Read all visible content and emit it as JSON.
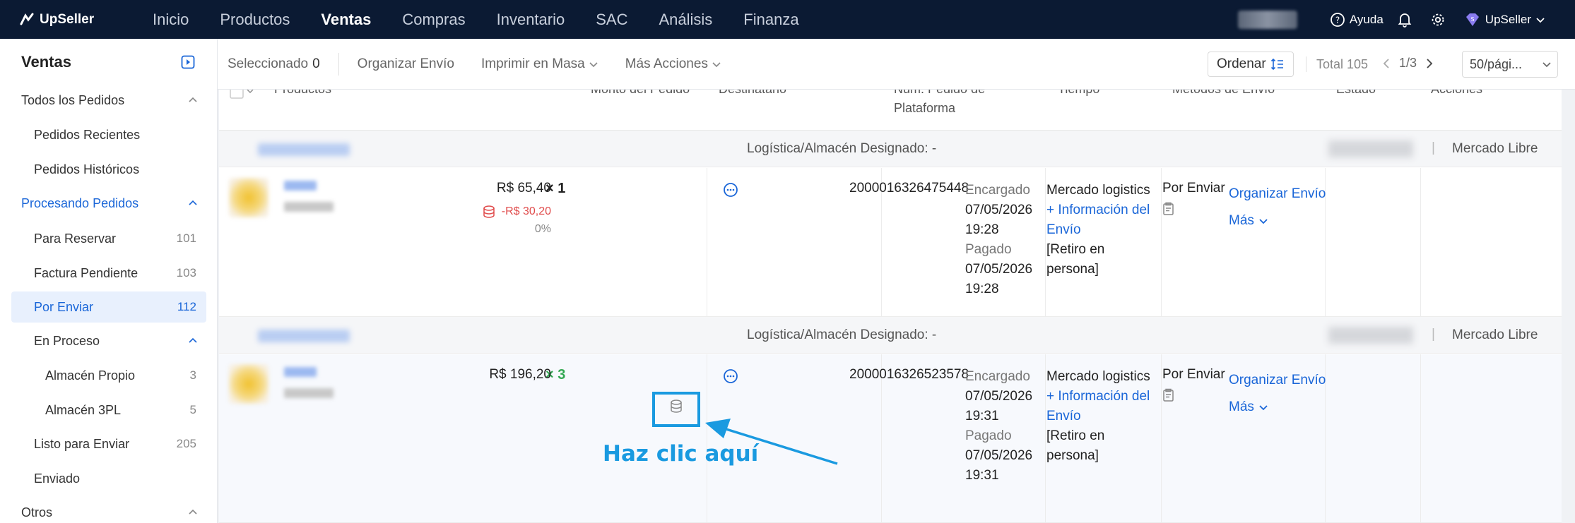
{
  "app": {
    "brand": "UpSeller",
    "nav": [
      "Inicio",
      "Productos",
      "Ventas",
      "Compras",
      "Inventario",
      "SAC",
      "Análisis",
      "Finanza"
    ],
    "active_nav": "Ventas",
    "help": "Ayuda",
    "user": "UpSeller"
  },
  "sidebar": {
    "title": "Ventas",
    "items": [
      {
        "label": "Todos los Pedidos",
        "count": ""
      },
      {
        "label": "Pedidos Recientes",
        "count": ""
      },
      {
        "label": "Pedidos Históricos",
        "count": ""
      },
      {
        "label": "Procesando Pedidos",
        "count": ""
      },
      {
        "label": "Para Reservar",
        "count": "101"
      },
      {
        "label": "Factura Pendiente",
        "count": "103"
      },
      {
        "label": "Por Enviar",
        "count": "112"
      },
      {
        "label": "En Proceso",
        "count": ""
      },
      {
        "label": "Almacén Propio",
        "count": "3"
      },
      {
        "label": "Almacén 3PL",
        "count": "5"
      },
      {
        "label": "Listo para Enviar",
        "count": "205"
      },
      {
        "label": "Enviado",
        "count": ""
      },
      {
        "label": "Otros",
        "count": ""
      }
    ]
  },
  "toolbar": {
    "selected_label": "Seleccionado",
    "selected_count": "0",
    "organize": "Organizar Envío",
    "print": "Imprimir en Masa",
    "more": "Más Acciones",
    "order": "Ordenar",
    "total": "Total 105",
    "page": "1/3",
    "per_page": "50/pági..."
  },
  "table": {
    "headers": {
      "products": "Productos",
      "amount": "Monto del Pedido",
      "recipient": "Destinatario",
      "order_no": "Núm. Pedido de Plataforma",
      "time": "Tiempo",
      "shipping": "Métodos de Envío",
      "status": "Estado",
      "actions": "Acciones"
    },
    "group_label": "Logística/Almacén Designado: -",
    "platform": "Mercado Libre",
    "rows": [
      {
        "qty": "× 1",
        "amount": "R$ 65,40",
        "discount": "-R$ 30,20",
        "percent": "0%",
        "order_no": "2000016326475448",
        "ordered_label": "Encargado",
        "ordered_date": "07/05/2026",
        "ordered_time": "19:28",
        "paid_label": "Pagado",
        "paid_date": "07/05/2026",
        "paid_time": "19:28",
        "ship_method": "Mercado logistics",
        "ship_info": "+ Información del Envío",
        "ship_type": "[Retiro en persona]",
        "status": "Por Enviar",
        "action": "Organizar Envío",
        "more": "Más"
      },
      {
        "qty": "× 3",
        "amount": "R$ 196,20",
        "order_no": "2000016326523578",
        "ordered_label": "Encargado",
        "ordered_date": "07/05/2026",
        "ordered_time": "19:31",
        "paid_label": "Pagado",
        "paid_date": "07/05/2026",
        "paid_time": "19:31",
        "ship_method": "Mercado logistics",
        "ship_info": "+ Información del Envío",
        "ship_type": "[Retiro en persona]",
        "status": "Por Enviar",
        "action": "Organizar Envío",
        "more": "Más"
      }
    ]
  },
  "annotation": {
    "callout": "Haz clic aquí"
  },
  "colors": {
    "nav_bg": "#0b1a33",
    "accent": "#1a66d8",
    "annotation": "#1a9ae0",
    "discount": "#e04b4b",
    "qty_green": "#34a853"
  }
}
